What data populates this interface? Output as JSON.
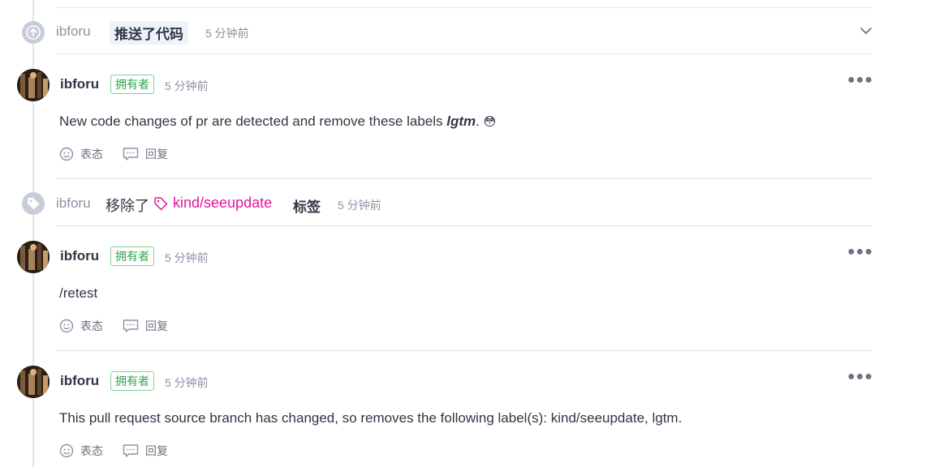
{
  "events": {
    "push": {
      "user": "ibforu",
      "action": "推送了代码",
      "time": "5 分钟前",
      "icon": "arrow-up-icon",
      "expand_icon": "chevron-down-icon"
    },
    "label_removed": {
      "user": "ibforu",
      "action": "移除了",
      "label": "kind/seeupdate",
      "suffix": "标签",
      "time": "5 分钟前",
      "icon": "tag-icon",
      "label_color": "#e6159e"
    }
  },
  "comments": [
    {
      "author": "ibforu",
      "badge": "拥有者",
      "time": "5 分钟前",
      "text_before": "New code changes of pr are detected and remove these labels ",
      "text_emphasis": "lgtm",
      "text_after": ". ",
      "emoji": "😳",
      "react_label": "表态",
      "reply_label": "回复"
    },
    {
      "author": "ibforu",
      "badge": "拥有者",
      "time": "5 分钟前",
      "text": "/retest",
      "react_label": "表态",
      "reply_label": "回复"
    },
    {
      "author": "ibforu",
      "badge": "拥有者",
      "time": "5 分钟前",
      "text": "This pull request source branch has changed, so removes the following label(s): kind/seeupdate, lgtm.",
      "react_label": "表态",
      "reply_label": "回复"
    }
  ],
  "colors": {
    "owner_badge": "#2ea44f",
    "timeline": "#e3e5ea"
  }
}
